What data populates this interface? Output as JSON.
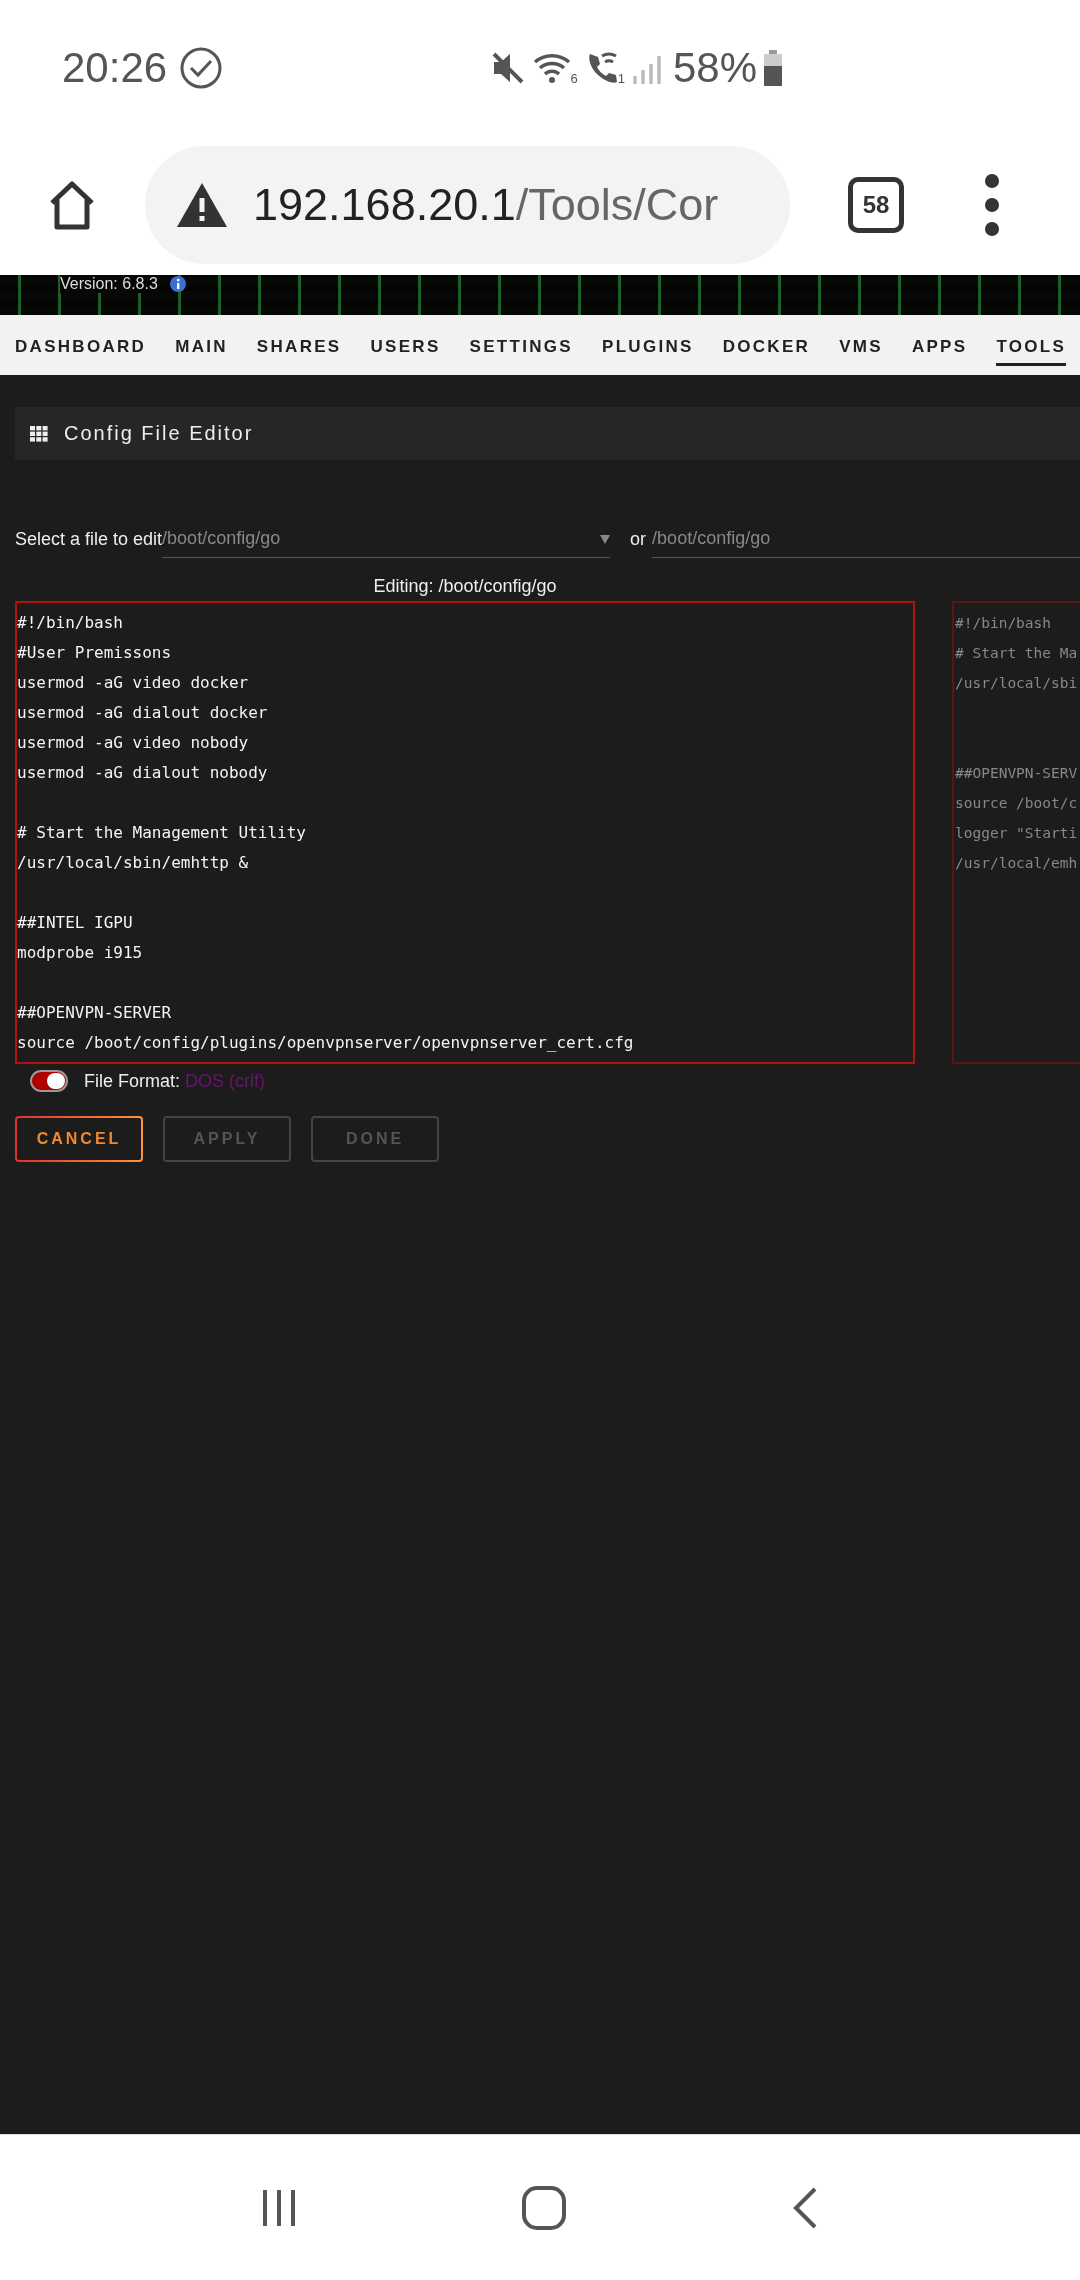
{
  "status_bar": {
    "time": "20:26",
    "wifi_badge": "6",
    "call_badge": "1",
    "battery": "58%"
  },
  "browser": {
    "url_host": "192.168.20.1",
    "url_path": "/Tools/Cor",
    "tab_count": "58"
  },
  "banner": {
    "version": "Version: 6.8.3"
  },
  "nav": [
    {
      "label": "DASHBOARD",
      "selected": false
    },
    {
      "label": "MAIN",
      "selected": false
    },
    {
      "label": "SHARES",
      "selected": false
    },
    {
      "label": "USERS",
      "selected": false
    },
    {
      "label": "SETTINGS",
      "selected": false
    },
    {
      "label": "PLUGINS",
      "selected": false
    },
    {
      "label": "DOCKER",
      "selected": false
    },
    {
      "label": "VMS",
      "selected": false
    },
    {
      "label": "APPS",
      "selected": false
    },
    {
      "label": "TOOLS",
      "selected": true
    }
  ],
  "panel": {
    "title": "Config File Editor"
  },
  "file_select": {
    "label": "Select a file to edit",
    "value": "/boot/config/go",
    "or_label": "or",
    "path_value": "/boot/config/go"
  },
  "editor": {
    "heading": "Editing: /boot/config/go",
    "lines": [
      {
        "kind": "text",
        "text": "#!/bin/bash"
      },
      {
        "kind": "text",
        "text": "#User Premissons"
      },
      {
        "kind": "text",
        "text": "usermod -aG video docker"
      },
      {
        "kind": "text",
        "text": "usermod -aG dialout docker"
      },
      {
        "kind": "text",
        "text": "usermod -aG video nobody"
      },
      {
        "kind": "text",
        "text": "usermod -aG dialout nobody"
      },
      {
        "kind": "blank"
      },
      {
        "kind": "text",
        "text": "# Start the Management Utility"
      },
      {
        "kind": "text",
        "text": "/usr/local/sbin/emhttp &"
      },
      {
        "kind": "blank"
      },
      {
        "kind": "text",
        "text": "##INTEL IGPU"
      },
      {
        "kind": "text",
        "text": "modprobe i915"
      },
      {
        "kind": "blank"
      },
      {
        "kind": "text",
        "text": "##OPENVPN-SERVER"
      },
      {
        "kind": "text",
        "text": "source /boot/config/plugins/openvpnserver/openvpnserver_cert.cfg"
      }
    ]
  },
  "preview": {
    "lines": [
      {
        "kind": "text",
        "text": "#!/bin/bash"
      },
      {
        "kind": "text",
        "text": "# Start the Ma"
      },
      {
        "kind": "text",
        "text": "/usr/local/sbi"
      },
      {
        "kind": "blank"
      },
      {
        "kind": "blank"
      },
      {
        "kind": "text",
        "text": "##OPENVPN-SERV"
      },
      {
        "kind": "text",
        "text": "source /boot/c"
      },
      {
        "kind": "text",
        "text": "logger \"Starti"
      },
      {
        "kind": "text",
        "text": "/usr/local/emh"
      }
    ]
  },
  "file_format": {
    "on": true,
    "label": "File Format:",
    "value": "DOS (crlf)"
  },
  "buttons": [
    {
      "label": "CANCEL",
      "disabled": false
    },
    {
      "label": "APPLY",
      "disabled": true
    },
    {
      "label": "DONE",
      "disabled": true
    }
  ]
}
